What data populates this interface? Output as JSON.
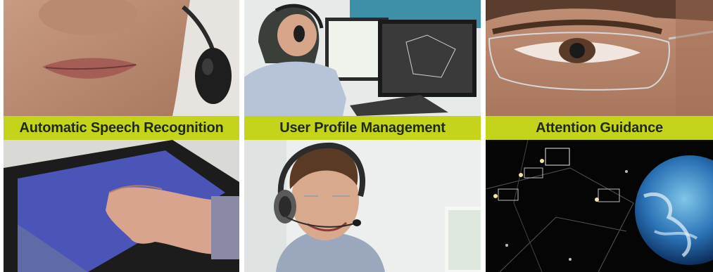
{
  "panels": [
    {
      "caption": "Automatic Speech Recognition",
      "top_photo": "mouth-with-headset-microphone",
      "bottom_photo": "hand-on-touchscreen-tablet"
    },
    {
      "caption": "User Profile Management",
      "top_photo": "controller-at-radar-workstation",
      "bottom_photo": "smiling-man-with-headset"
    },
    {
      "caption": "Attention Guidance",
      "top_photo": "eye-with-glasses",
      "bottom_photo": "radar-display-with-earth"
    }
  ],
  "colors": {
    "band": "#c4d41b",
    "caption_text": "#1e2a14"
  }
}
